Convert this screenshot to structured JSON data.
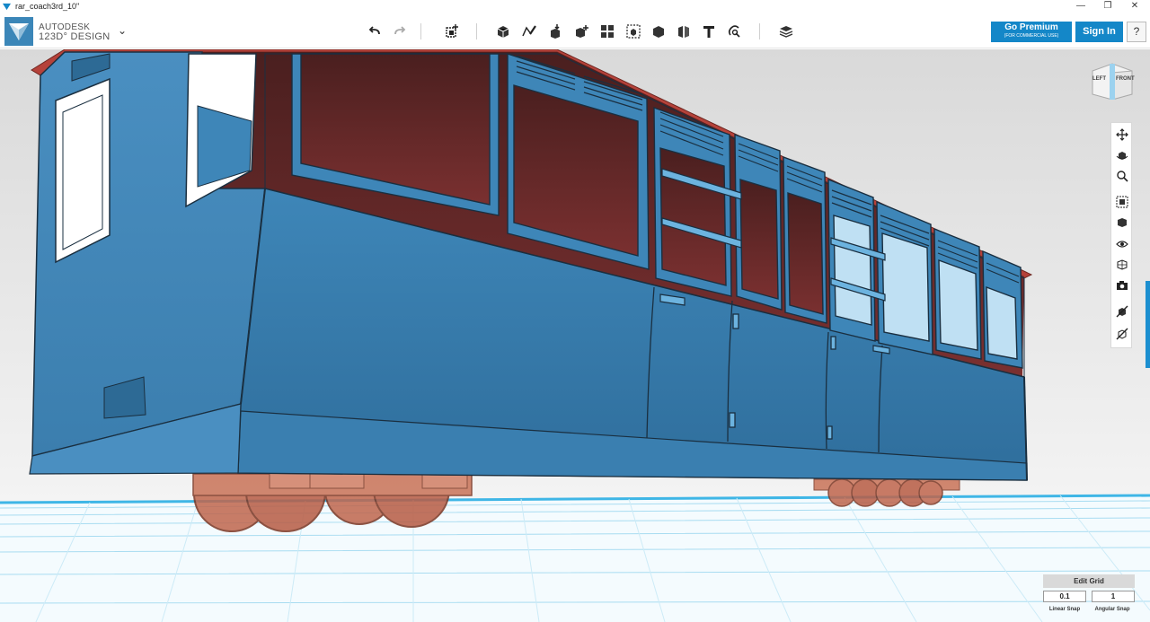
{
  "window": {
    "title": "rar_coach3rd_10\"",
    "minimize": "—",
    "maximize": "❐",
    "close": "✕"
  },
  "brand": {
    "line1": "AUTODESK",
    "line2": "123D° DESIGN",
    "caret": "⌄"
  },
  "toolbar": {
    "tools": [
      "undo-icon",
      "redo-icon",
      "transform-icon",
      "primitives-icon",
      "sketch-icon",
      "construct-icon",
      "modify-icon",
      "pattern-icon",
      "grouping-icon",
      "combine-icon",
      "measure-icon",
      "text-icon",
      "snap-icon",
      "materials-icon"
    ]
  },
  "account": {
    "premium_label": "Go Premium",
    "premium_sub": "(FOR COMMERCIAL USE)",
    "signin_label": "Sign In",
    "help_label": "?"
  },
  "viewcube": {
    "left_label": "LEFT",
    "front_label": "FRONT"
  },
  "navbar": {
    "buttons": [
      "pan-icon",
      "orbit-icon",
      "zoom-icon",
      "fit-icon",
      "views-icon",
      "visibility-icon",
      "materials-outline-icon",
      "camera-icon",
      "hide-icon",
      "show-hidden-icon"
    ]
  },
  "grid": {
    "title": "Edit Grid",
    "linear_snap_value": "0.1",
    "linear_snap_label": "Linear Snap",
    "angular_snap_value": "1",
    "angular_snap_label": "Angular Snap"
  },
  "colors": {
    "accent": "#1487c8",
    "coach_body": "#3a7fb0",
    "coach_roof": "#b5423a",
    "interior": "#6b2b2b",
    "wheels": "#c0664d",
    "grid_blue": "#63c8ec"
  }
}
